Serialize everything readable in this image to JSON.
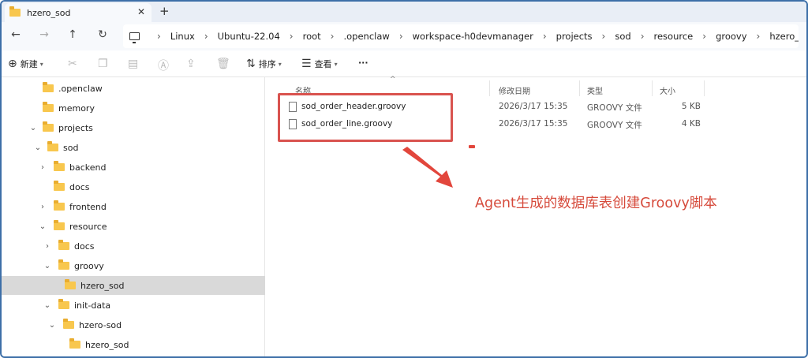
{
  "window": {
    "tab_title": "hzero_sod",
    "tab_close": "✕",
    "new_tab": "+"
  },
  "navigation": {
    "back": "←",
    "forward": "→",
    "up": "↑",
    "refresh": "↻"
  },
  "breadcrumb": [
    "Linux",
    "Ubuntu-22.04",
    "root",
    ".openclaw",
    "workspace-h0devmanager",
    "projects",
    "sod",
    "resource",
    "groovy",
    "hzero_sod"
  ],
  "commands": {
    "new_label": "新建",
    "sort_label": "排序",
    "view_label": "查看",
    "more_label": "···"
  },
  "sidebar": {
    "items": [
      {
        "label": ".openclaw",
        "chevron": ""
      },
      {
        "label": "memory",
        "chevron": ""
      },
      {
        "label": "projects",
        "chevron": "⌄"
      },
      {
        "label": "sod",
        "chevron": "⌄"
      },
      {
        "label": "backend",
        "chevron": "›"
      },
      {
        "label": "docs",
        "chevron": ""
      },
      {
        "label": "frontend",
        "chevron": "›"
      },
      {
        "label": "resource",
        "chevron": "⌄"
      },
      {
        "label": "docs",
        "chevron": "›"
      },
      {
        "label": "groovy",
        "chevron": "⌄"
      },
      {
        "label": "hzero_sod",
        "chevron": "",
        "selected": true
      },
      {
        "label": "init-data",
        "chevron": "⌄"
      },
      {
        "label": "hzero-sod",
        "chevron": "⌄"
      },
      {
        "label": "hzero_sod",
        "chevron": ""
      }
    ]
  },
  "columns": {
    "name": "名称",
    "modified": "修改日期",
    "type": "类型",
    "size": "大小"
  },
  "files": [
    {
      "name": "sod_order_header.groovy",
      "modified": "2026/3/17 15:35",
      "type": "GROOVY 文件",
      "size": "5 KB"
    },
    {
      "name": "sod_order_line.groovy",
      "modified": "2026/3/17 15:35",
      "type": "GROOVY 文件",
      "size": "4 KB"
    }
  ],
  "annotation": {
    "text": "Agent生成的数据库表创建Groovy脚本",
    "color": "#d64a3b"
  }
}
